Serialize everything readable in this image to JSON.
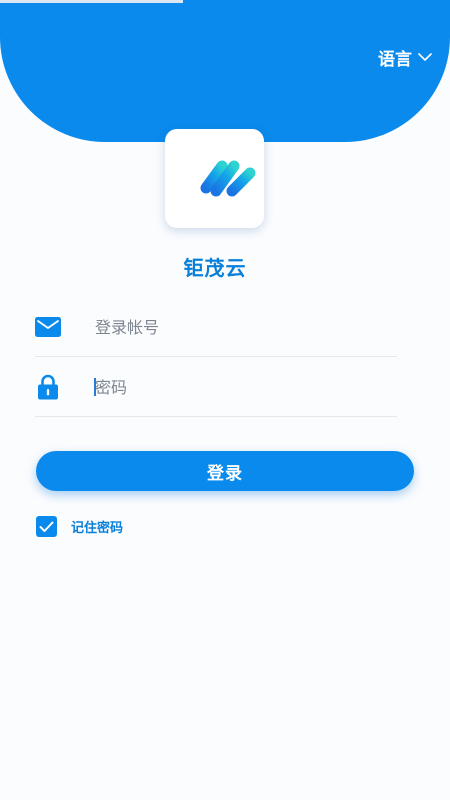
{
  "header": {
    "language_label": "语言",
    "language_icon": "chevron-down-icon"
  },
  "app": {
    "name": "钜茂云",
    "logo_icon": "app-logo"
  },
  "form": {
    "account": {
      "placeholder": "登录帐号",
      "value": "",
      "icon": "mail-icon"
    },
    "password": {
      "placeholder": "密码",
      "value": "",
      "icon": "lock-icon"
    },
    "login_label": "登录",
    "remember": {
      "label": "记住密码",
      "checked": true
    }
  },
  "colors": {
    "primary": "#0a8aec",
    "text_accent": "#0a7fd8",
    "background": "#fbfcfe"
  }
}
